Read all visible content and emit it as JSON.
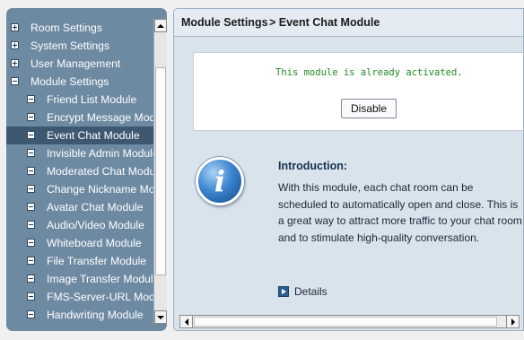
{
  "sidebar": {
    "items": [
      {
        "label": "Room Settings",
        "level": "top",
        "toggle": "plus"
      },
      {
        "label": "System Settings",
        "level": "top",
        "toggle": "plus"
      },
      {
        "label": "User Management",
        "level": "top",
        "toggle": "plus"
      },
      {
        "label": "Module Settings",
        "level": "top",
        "toggle": "minus"
      },
      {
        "label": "Friend List Module",
        "level": "child",
        "toggle": "minus"
      },
      {
        "label": "Encrypt Message Module",
        "level": "child",
        "toggle": "minus"
      },
      {
        "label": "Event Chat Module",
        "level": "child",
        "toggle": "minus",
        "selected": true
      },
      {
        "label": "Invisible Admin Module",
        "level": "child",
        "toggle": "minus"
      },
      {
        "label": "Moderated Chat Module",
        "level": "child",
        "toggle": "minus"
      },
      {
        "label": "Change Nickname Module",
        "level": "child",
        "toggle": "minus"
      },
      {
        "label": "Avatar Chat Module",
        "level": "child",
        "toggle": "minus"
      },
      {
        "label": "Audio/Video Module",
        "level": "child",
        "toggle": "minus"
      },
      {
        "label": "Whiteboard Module",
        "level": "child",
        "toggle": "minus"
      },
      {
        "label": "File Transfer Module",
        "level": "child",
        "toggle": "minus"
      },
      {
        "label": "Image Transfer Module",
        "level": "child",
        "toggle": "minus"
      },
      {
        "label": "FMS-Server-URL Module",
        "level": "child",
        "toggle": "minus"
      },
      {
        "label": "Handwriting Module",
        "level": "child",
        "toggle": "minus"
      }
    ]
  },
  "header": {
    "section": "Module Settings",
    "page": "> Event Chat Module"
  },
  "status": {
    "message": "This module is already activated.",
    "button_label": "Disable"
  },
  "intro": {
    "title": "Introduction:",
    "lines": [
      "With this module, each chat room can be",
      "scheduled to automatically open and close. This is",
      "a great way to attract more traffic to your chat room",
      "and to stimulate high-quality conversation."
    ]
  },
  "details_label": "Details",
  "icons": {
    "info": "information-icon",
    "details": "play-arrow-icon",
    "expand": "plus-square-icon",
    "collapse": "minus-square-icon"
  },
  "colors": {
    "sidebar_bg": "#6e8aa3",
    "sidebar_selected": "#3e5871",
    "status_text": "#1f8a1f",
    "panel_bg": "#d9e3ec"
  }
}
